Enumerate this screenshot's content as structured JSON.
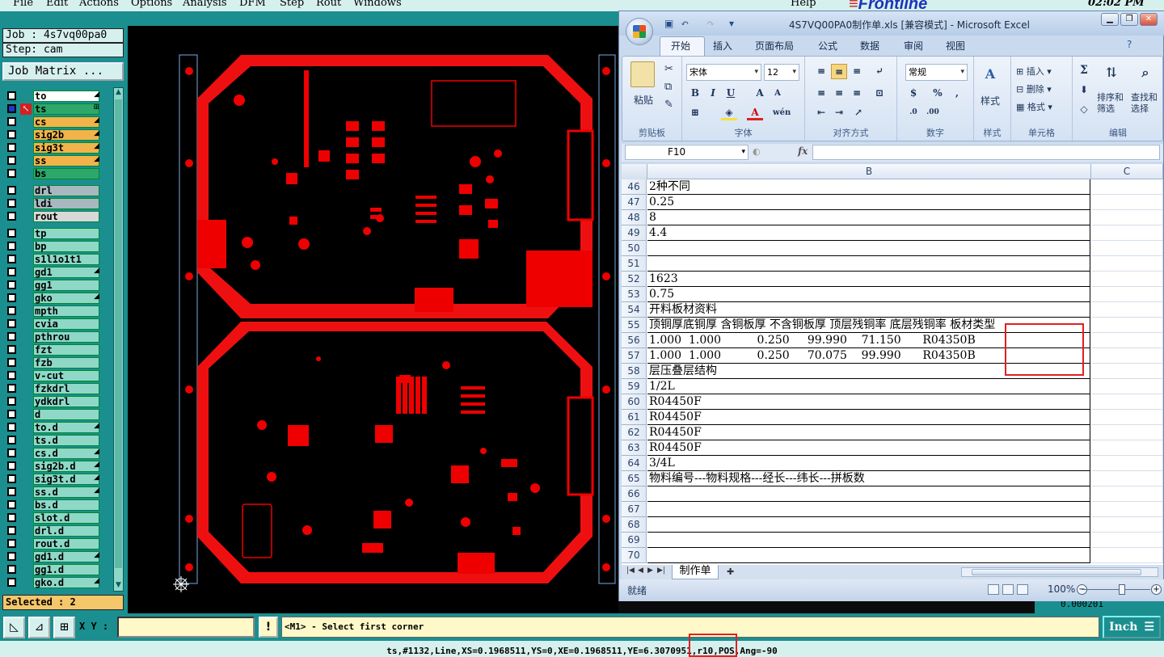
{
  "cam": {
    "menu": [
      "File",
      "Edit",
      "Actions",
      "Options",
      "Analysis",
      "DFM",
      "Step",
      "Rout",
      "Windows"
    ],
    "help": "Help",
    "brand": "Frontline",
    "clock": "02:02 PM",
    "job": "Job : 4s7vq00pa0",
    "step": "Step: cam",
    "job_matrix": "Job Matrix ...",
    "selected": "Selected : 2",
    "layers": [
      {
        "name": "to",
        "color": "#ffffff",
        "mark": "◢"
      },
      {
        "name": "ts",
        "color": "#2ea86a",
        "mark": "⊞"
      },
      {
        "name": "cs",
        "color": "#f2b44a",
        "mark": "◢"
      },
      {
        "name": "sig2b",
        "color": "#f2b44a",
        "mark": "◢"
      },
      {
        "name": "sig3t",
        "color": "#f2b44a",
        "mark": "◢"
      },
      {
        "name": "ss",
        "color": "#f2b44a",
        "mark": "◢"
      },
      {
        "name": "bs",
        "color": "#2ea86a",
        "mark": ""
      },
      {
        "name": "drl",
        "color": "#a8b8c0",
        "mark": ""
      },
      {
        "name": "ldi",
        "color": "#a8b8c0",
        "mark": ""
      },
      {
        "name": "rout",
        "color": "#d8d8d8",
        "mark": ""
      },
      {
        "name": "tp",
        "color": "#8fd8c8",
        "mark": ""
      },
      {
        "name": "bp",
        "color": "#8fd8c8",
        "mark": ""
      },
      {
        "name": "s1l1o1t1",
        "color": "#8fd8c8",
        "mark": ""
      },
      {
        "name": "gd1",
        "color": "#8fd8c8",
        "mark": "◢"
      },
      {
        "name": "gg1",
        "color": "#8fd8c8",
        "mark": ""
      },
      {
        "name": "gko",
        "color": "#8fd8c8",
        "mark": "◢"
      },
      {
        "name": "mpth",
        "color": "#8fd8c8",
        "mark": ""
      },
      {
        "name": "cvia",
        "color": "#8fd8c8",
        "mark": ""
      },
      {
        "name": "pthrou",
        "color": "#8fd8c8",
        "mark": ""
      },
      {
        "name": "fzt",
        "color": "#8fd8c8",
        "mark": ""
      },
      {
        "name": "fzb",
        "color": "#8fd8c8",
        "mark": ""
      },
      {
        "name": "v-cut",
        "color": "#8fd8c8",
        "mark": ""
      },
      {
        "name": "fzkdrl",
        "color": "#8fd8c8",
        "mark": ""
      },
      {
        "name": "ydkdrl",
        "color": "#8fd8c8",
        "mark": ""
      },
      {
        "name": "d",
        "color": "#8fd8c8",
        "mark": ""
      },
      {
        "name": "to.d",
        "color": "#8fd8c8",
        "mark": "◢"
      },
      {
        "name": "ts.d",
        "color": "#8fd8c8",
        "mark": ""
      },
      {
        "name": "cs.d",
        "color": "#8fd8c8",
        "mark": "◢"
      },
      {
        "name": "sig2b.d",
        "color": "#8fd8c8",
        "mark": "◢"
      },
      {
        "name": "sig3t.d",
        "color": "#8fd8c8",
        "mark": "◢"
      },
      {
        "name": "ss.d",
        "color": "#8fd8c8",
        "mark": "◢"
      },
      {
        "name": "bs.d",
        "color": "#8fd8c8",
        "mark": ""
      },
      {
        "name": "slot.d",
        "color": "#8fd8c8",
        "mark": ""
      },
      {
        "name": "drl.d",
        "color": "#8fd8c8",
        "mark": ""
      },
      {
        "name": "rout.d",
        "color": "#8fd8c8",
        "mark": ""
      },
      {
        "name": "gd1.d",
        "color": "#8fd8c8",
        "mark": "◢"
      },
      {
        "name": "gg1.d",
        "color": "#8fd8c8",
        "mark": ""
      },
      {
        "name": "gko.d",
        "color": "#8fd8c8",
        "mark": "◢"
      }
    ],
    "xy_label": "X Y :",
    "xy_value": "",
    "prompt": "<M1> - Select first corner",
    "units": "Inch",
    "status": "ts,#1132,Line,XS=0.1968511,YS=0,XE=0.1968511,YE=6.3070951,r10,POS,Ang=-90",
    "behind_value": "0.000201"
  },
  "excel": {
    "title": "4S7VQ00PA0制作单.xls  [兼容模式] - Microsoft Excel",
    "tabs": [
      "开始",
      "插入",
      "页面布局",
      "公式",
      "数据",
      "审阅",
      "视图"
    ],
    "groups": {
      "clipboard": {
        "label": "剪贴板",
        "paste": "粘贴"
      },
      "font": {
        "label": "字体",
        "name": "宋体",
        "size": "12"
      },
      "align": {
        "label": "对齐方式"
      },
      "number": {
        "label": "数字",
        "format": "常规"
      },
      "styles": {
        "label": "样式",
        "button": "样式"
      },
      "cells": {
        "label": "单元格",
        "insert": "插入",
        "delete": "删除",
        "format": "格式"
      },
      "editing": {
        "label": "编辑",
        "sort": "排序和筛选",
        "find": "查找和选择"
      }
    },
    "name_box": "F10",
    "formula": "",
    "columns": [
      "B",
      "C"
    ],
    "rows": [
      {
        "n": "46",
        "b": "2种不同"
      },
      {
        "n": "47",
        "b": "0.25"
      },
      {
        "n": "48",
        "b": "8"
      },
      {
        "n": "49",
        "b": "4.4"
      },
      {
        "n": "50",
        "b": ""
      },
      {
        "n": "51",
        "b": ""
      },
      {
        "n": "52",
        "b": "1623"
      },
      {
        "n": "53",
        "b": "0.75"
      },
      {
        "n": "54",
        "b": "开料板材资料"
      },
      {
        "n": "55",
        "b": "顶铜厚底铜厚 含铜板厚 不含铜板厚 顶层残铜率 底层残铜率 板材类型"
      },
      {
        "n": "56",
        "b": "1.000  1.000          0.250     99.990    71.150      R04350B"
      },
      {
        "n": "57",
        "b": "1.000  1.000          0.250     70.075    99.990      R04350B"
      },
      {
        "n": "58",
        "b": "层压叠层结构"
      },
      {
        "n": "59",
        "b": "1/2L"
      },
      {
        "n": "60",
        "b": "R04450F"
      },
      {
        "n": "61",
        "b": "R04450F"
      },
      {
        "n": "62",
        "b": "R04450F"
      },
      {
        "n": "63",
        "b": "R04450F"
      },
      {
        "n": "64",
        "b": "3/4L"
      },
      {
        "n": "65",
        "b": "物料编号---物料规格---经长---纬长---拼板数"
      },
      {
        "n": "66",
        "b": ""
      },
      {
        "n": "67",
        "b": ""
      },
      {
        "n": "68",
        "b": ""
      },
      {
        "n": "69",
        "b": ""
      },
      {
        "n": "70",
        "b": ""
      }
    ],
    "sheet_tab": "制作单",
    "status_ready": "就绪",
    "zoom": "100%"
  }
}
